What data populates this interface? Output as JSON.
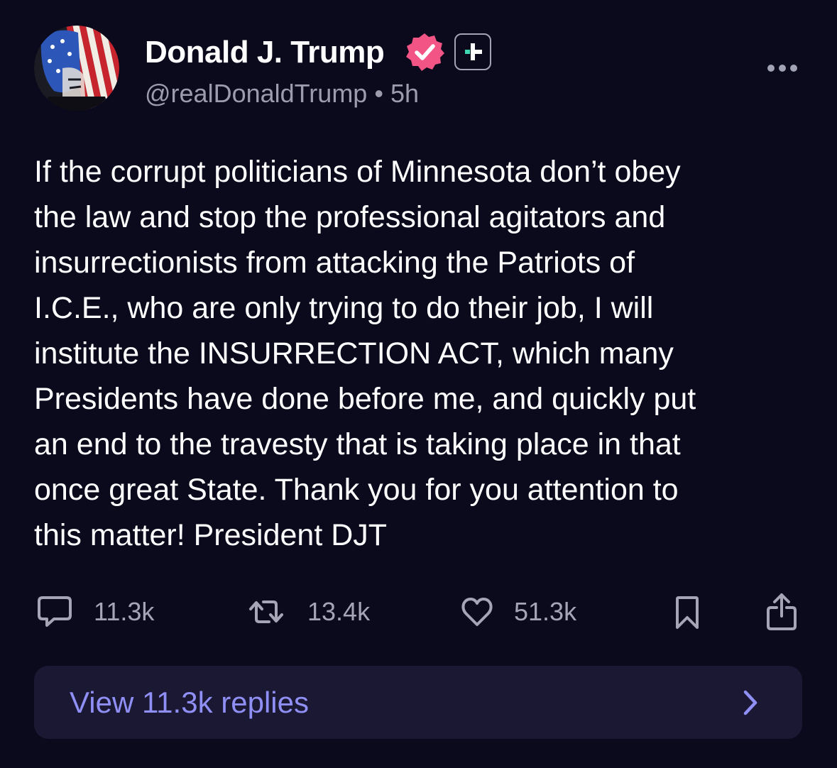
{
  "author": {
    "display_name": "Donald J. Trump",
    "handle": "@realDonaldTrump",
    "separator": "•",
    "time_ago": "5h",
    "avatar_icon": "avatar-flag-portrait",
    "verified_icon": "verified-check-icon",
    "plus_icon": "plus-badge-icon",
    "verified_color": "#f25585"
  },
  "post": {
    "text": "If the corrupt politicians of Minnesota don’t obey\nthe law and stop the professional agitators and\ninsurrectionists from attacking the Patriots of\nI.C.E., who are only trying to do their job, I will\ninstitute the INSURRECTION ACT, which many\nPresidents have done before me, and quickly put\nan end to the travesty that is taking place in that\nonce great State. Thank you for you attention to\nthis matter! President DJT"
  },
  "actions": {
    "replies": "11.3k",
    "reposts": "13.4k",
    "likes": "51.3k",
    "icons": [
      "reply-icon",
      "repost-icon",
      "heart-icon",
      "bookmark-icon",
      "share-icon"
    ]
  },
  "view_replies": {
    "label": "View 11.3k replies",
    "accent_color": "#8f8ff5"
  },
  "colors": {
    "background": "#0b0a1c",
    "secondary_text": "#9c9cad",
    "panel": "#1a1833",
    "plus_accent": "#3fd9b1"
  }
}
